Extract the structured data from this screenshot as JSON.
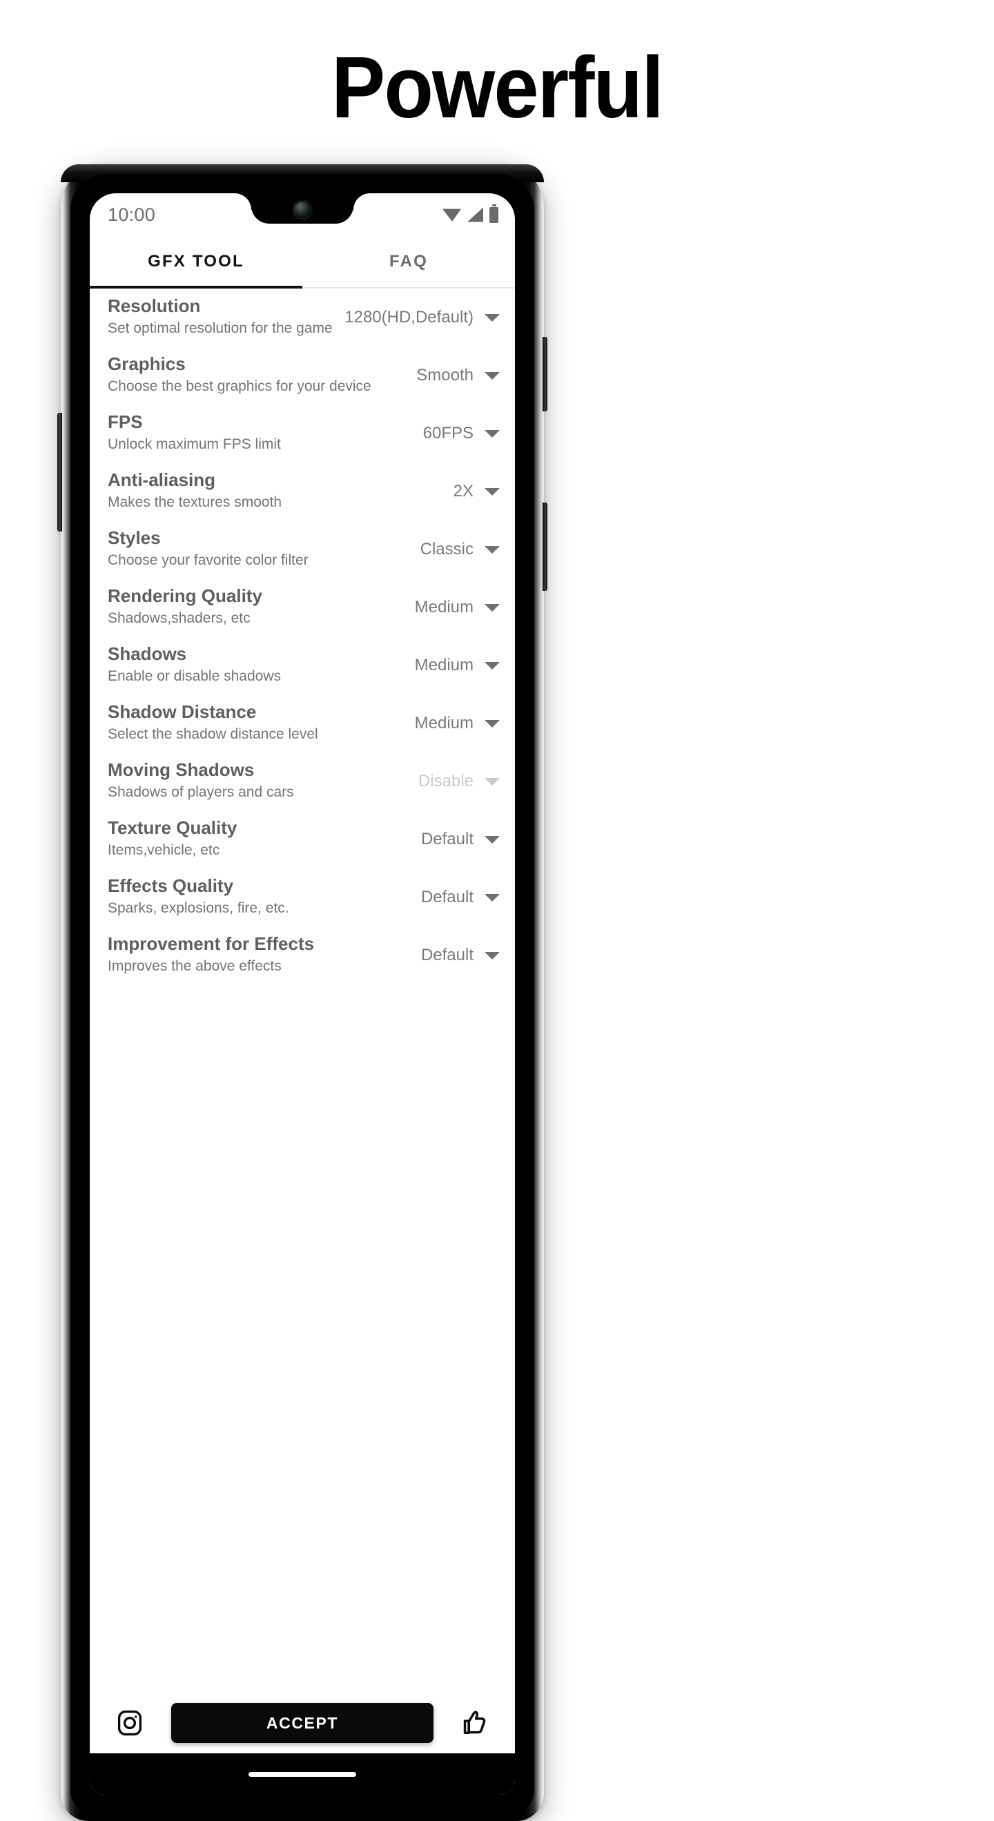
{
  "hero": {
    "title": "Powerful"
  },
  "status_bar": {
    "time": "10:00",
    "icons": [
      "wifi-icon",
      "cellular-signal-icon",
      "battery-icon"
    ]
  },
  "tabs": [
    {
      "label": "GFX TOOL",
      "active": true
    },
    {
      "label": "FAQ",
      "active": false
    }
  ],
  "settings": [
    {
      "title": "Resolution",
      "subtitle": "Set optimal resolution for the game",
      "value": "1280(HD,Default)",
      "disabled": false
    },
    {
      "title": "Graphics",
      "subtitle": "Choose the best graphics for your device",
      "value": "Smooth",
      "disabled": false
    },
    {
      "title": "FPS",
      "subtitle": "Unlock maximum FPS limit",
      "value": "60FPS",
      "disabled": false
    },
    {
      "title": "Anti-aliasing",
      "subtitle": "Makes the textures smooth",
      "value": "2X",
      "disabled": false
    },
    {
      "title": "Styles",
      "subtitle": "Choose your favorite color filter",
      "value": "Classic",
      "disabled": false
    },
    {
      "title": "Rendering Quality",
      "subtitle": "Shadows,shaders, etc",
      "value": "Medium",
      "disabled": false
    },
    {
      "title": "Shadows",
      "subtitle": "Enable or disable shadows",
      "value": "Medium",
      "disabled": false
    },
    {
      "title": "Shadow Distance",
      "subtitle": "Select the shadow distance level",
      "value": "Medium",
      "disabled": false
    },
    {
      "title": "Moving Shadows",
      "subtitle": "Shadows of players and cars",
      "value": "Disable",
      "disabled": true
    },
    {
      "title": "Texture Quality",
      "subtitle": "Items,vehicle, etc",
      "value": "Default",
      "disabled": false
    },
    {
      "title": "Effects Quality",
      "subtitle": "Sparks, explosions, fire, etc.",
      "value": "Default",
      "disabled": false
    },
    {
      "title": "Improvement for Effects",
      "subtitle": "Improves the above effects",
      "value": "Default",
      "disabled": false
    }
  ],
  "bottom_bar": {
    "instagram_icon": "instagram-icon",
    "accept_label": "ACCEPT",
    "like_icon": "thumbs-up-icon"
  },
  "colors": {
    "accent": "#0a0a0a",
    "title_text": "#5f5f5f",
    "subtitle_text": "#757575",
    "value_text": "#7a7a7a",
    "value_disabled": "#c9c9c9",
    "tab_active": "#111111",
    "tab_inactive": "#6d6d6d"
  }
}
